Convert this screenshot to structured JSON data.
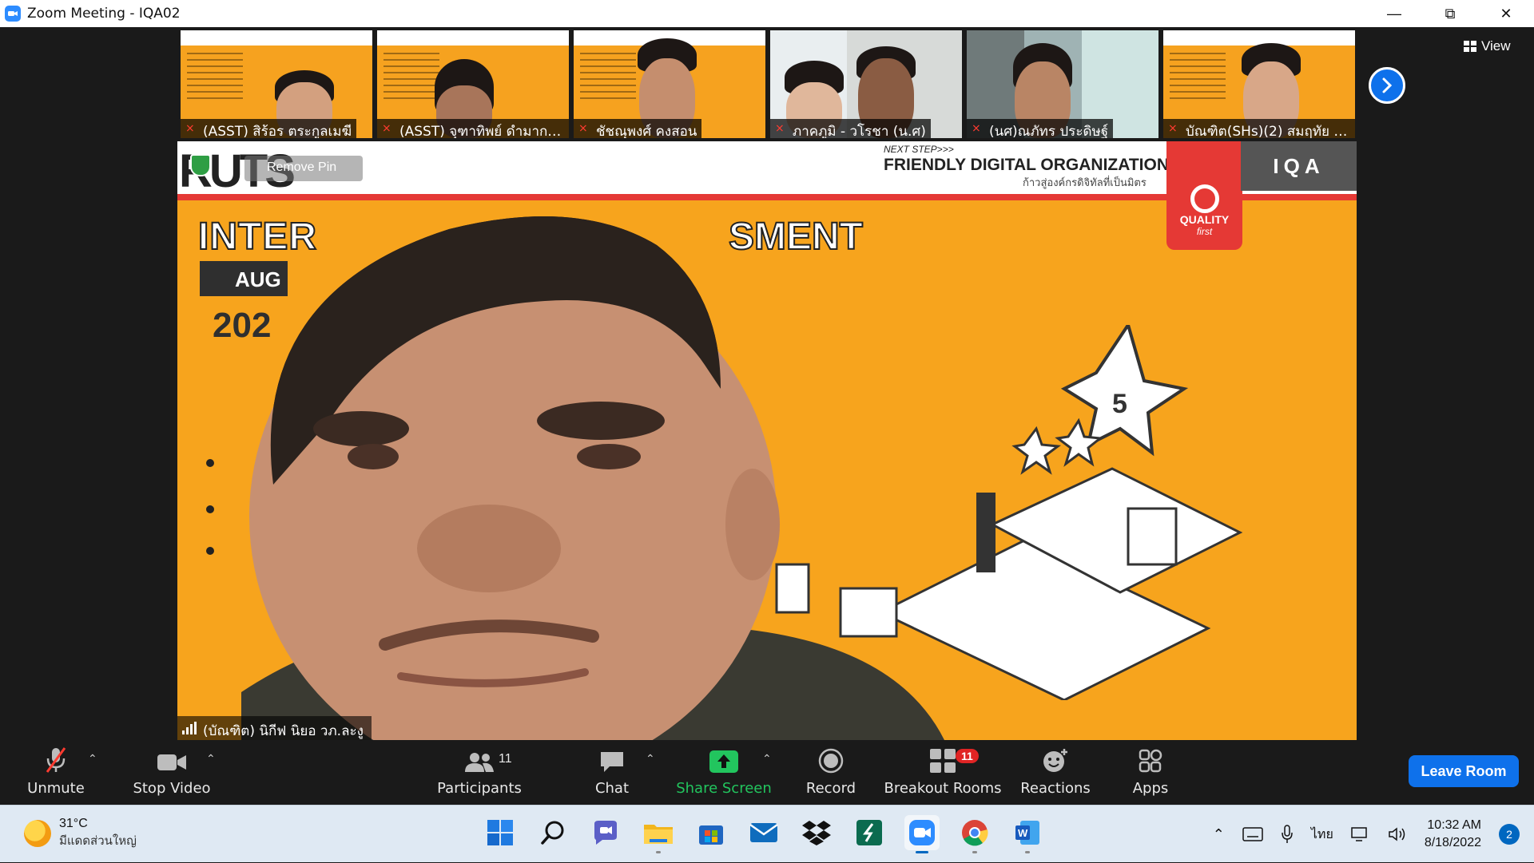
{
  "window": {
    "title": "Zoom Meeting - IQA02",
    "controls": [
      "minimize",
      "restore",
      "close"
    ]
  },
  "gallery": {
    "view_label": "View",
    "participants": [
      {
        "name": "(ASST) สิร้อร  ตระกูลเมฆี",
        "muted": true,
        "kind": "slide"
      },
      {
        "name": "(ASST) จุฑาทิพย์ ดำมาก ...",
        "muted": true,
        "kind": "slide"
      },
      {
        "name": "ชัชณุพงศ์ คงสอน",
        "muted": true,
        "kind": "slide"
      },
      {
        "name": "ภาคภูมิ - วโรชา (น.ศ)",
        "muted": true,
        "kind": "photo"
      },
      {
        "name": "(นศ)ณภัทร ประดิษฐ์",
        "muted": true,
        "kind": "room"
      },
      {
        "name": "บัณฑิต(SHs)(2) สมฤทัย อิ...",
        "muted": true,
        "kind": "slide"
      }
    ]
  },
  "main_video": {
    "speaker_name": "(บัณฑิต) นิกีฟ นิยอ วภ.ละงู",
    "pin_label": "Remove Pin",
    "background": {
      "logo": "RUTS",
      "next_step": "NEXT STEP>>>",
      "tagline": "FRIENDLY DIGITAL ORGANIZATION",
      "tagline_thai": "ก้าวสู่องค์กรดิจิทัลที่เป็นมิตร",
      "heading_left": "INTER",
      "heading_right": "SMENT",
      "month": "AUG",
      "year": "202",
      "quality": "QUALITY",
      "quality_sub": "first",
      "iqa": "IQA"
    }
  },
  "toolbar": {
    "unmute": "Unmute",
    "stop_video": "Stop Video",
    "participants": "Participants",
    "participants_count": "11",
    "chat": "Chat",
    "share_screen": "Share Screen",
    "record": "Record",
    "breakout_rooms": "Breakout Rooms",
    "breakout_count": "11",
    "reactions": "Reactions",
    "apps": "Apps",
    "leave": "Leave Room"
  },
  "taskbar": {
    "weather_temp": "31°C",
    "weather_desc": "มีแดดส่วนใหญ่",
    "apps": [
      "start-icon",
      "search-icon",
      "teams-chat-icon",
      "file-explorer-icon",
      "microsoft-store-icon",
      "mail-icon",
      "dropbox-icon",
      "app-s-icon",
      "zoom-icon",
      "chrome-icon",
      "word-icon"
    ],
    "language": "ไทย",
    "time": "10:32 AM",
    "date": "8/18/2022",
    "notifications": "2"
  },
  "colors": {
    "zoom_blue": "#0e71eb",
    "mute_red": "#ff3b30",
    "share_green": "#22c55e",
    "slide_orange": "#f7a41d"
  }
}
